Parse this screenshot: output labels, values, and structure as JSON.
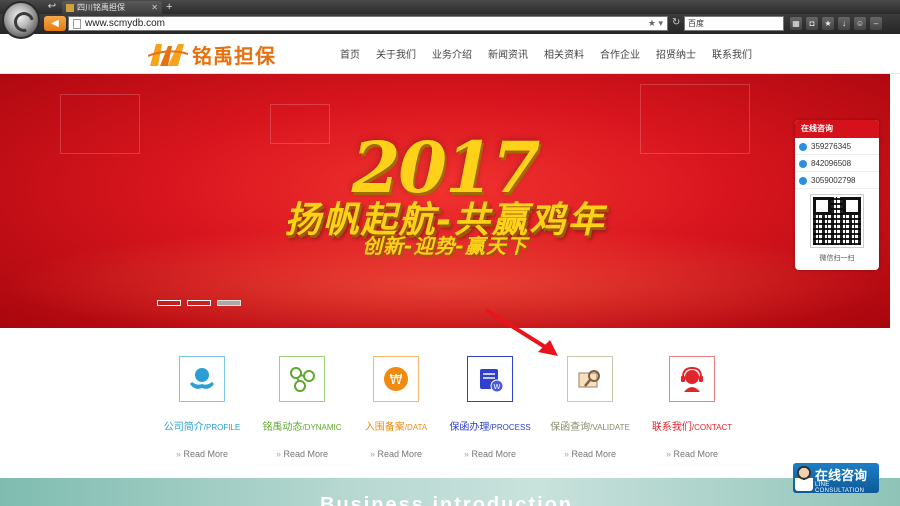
{
  "browser": {
    "tab_title": "四川铭禹担保",
    "url": "www.scmydb.com",
    "new_tab": "+",
    "back": "◀",
    "search_placeholder": "百度"
  },
  "site": {
    "logo_text": "铭禹担保",
    "nav": [
      "首页",
      "关于我们",
      "业务介绍",
      "新闻资讯",
      "相关资料",
      "合作企业",
      "招贤纳士",
      "联系我们"
    ]
  },
  "banner": {
    "year": "2017",
    "headline": "扬帆起航-共赢鸡年",
    "subline": "创新-迎势-赢天下",
    "dots": 3,
    "active_dot": 2
  },
  "consult_panel": {
    "title": "在线咨询",
    "qq": [
      "359276345",
      "842096508",
      "3059002798"
    ],
    "qr_note": "微信扫一扫"
  },
  "services": [
    {
      "cn": "公司简介",
      "en": "/PROFILE",
      "color": "#2a9fd6",
      "icon": "hands-globe-icon",
      "more": "Read More"
    },
    {
      "cn": "铭禹动态",
      "en": "/DYNAMIC",
      "color": "#5fa830",
      "icon": "network-icon",
      "more": "Read More"
    },
    {
      "cn": "入围备案",
      "en": "/DATA",
      "color": "#f08a10",
      "icon": "coin-icon",
      "more": "Read More"
    },
    {
      "cn": "保函办理",
      "en": "/PROCESS",
      "color": "#2f3fcf",
      "icon": "document-icon",
      "more": "Read More"
    },
    {
      "cn": "保函查询",
      "en": "/VALIDATE",
      "color": "#8a8a70",
      "icon": "magnifier-icon",
      "more": "Read More"
    },
    {
      "cn": "联系我们",
      "en": "/CONTACT",
      "color": "#e0262c",
      "icon": "headset-icon",
      "more": "Read More"
    }
  ],
  "bottom_text": "Business introduction",
  "consult_badge": {
    "title": "在线咨询",
    "subtitle": "LINE CONSULTATION"
  }
}
